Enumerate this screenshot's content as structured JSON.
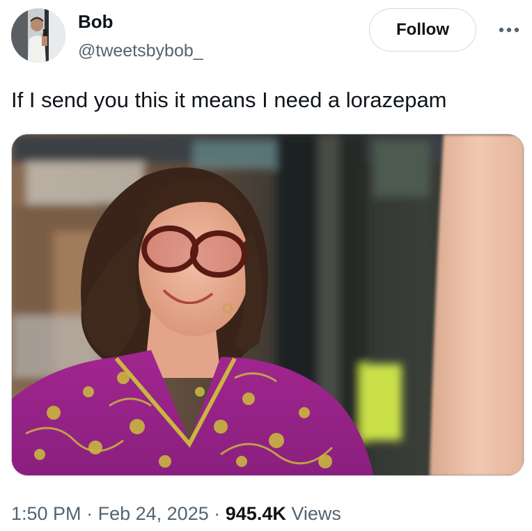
{
  "author": {
    "name": "Bob",
    "handle": "@tweetsbybob_",
    "avatar_icon": "profile-photo"
  },
  "actions": {
    "follow_label": "Follow",
    "more_icon": "more-dots-icon"
  },
  "tweet": {
    "text": "If I send you this it means I need a lorazepam"
  },
  "meta": {
    "time": "1:50 PM",
    "separator": "·",
    "date": "Feb 24, 2025",
    "views_count": "945.4K",
    "views_label": "Views"
  },
  "colors": {
    "text_primary": "#0f1419",
    "text_secondary": "#536471",
    "border": "#cfd9de",
    "background": "#ffffff"
  }
}
